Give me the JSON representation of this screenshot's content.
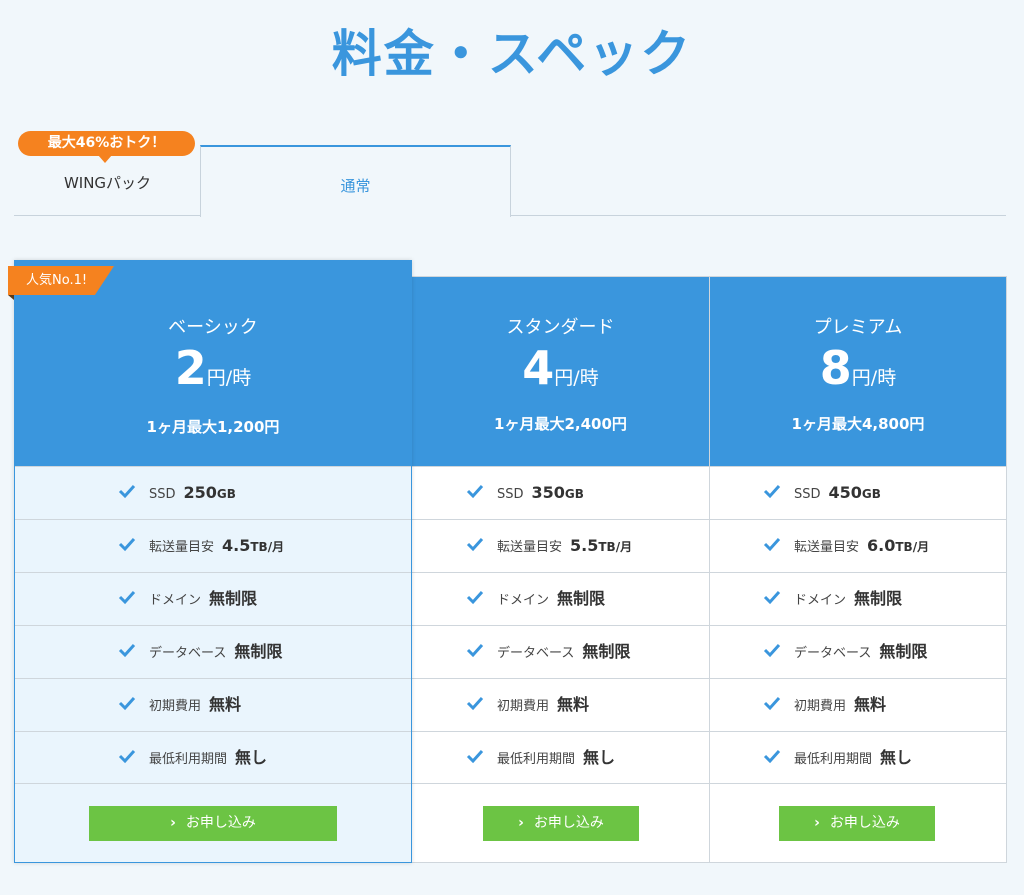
{
  "page_title": "料金・スペック",
  "tabs": {
    "wing": {
      "label": "WINGパック",
      "badge": "最大46%おトク！"
    },
    "normal": {
      "label": "通常"
    }
  },
  "popular_badge": "人気No.1!",
  "plans": [
    {
      "name": "ベーシック",
      "price": "2",
      "price_unit": "円/時",
      "monthly": "1ヶ月最大1,200円",
      "specs": [
        {
          "label": "SSD",
          "value": "250",
          "unit": "GB"
        },
        {
          "label": "転送量目安",
          "value": "4.5",
          "unit": "TB/月"
        },
        {
          "label": "ドメイン",
          "value": "無制限",
          "unit": ""
        },
        {
          "label": "データベース",
          "value": "無制限",
          "unit": ""
        },
        {
          "label": "初期費用",
          "value": "無料",
          "unit": ""
        },
        {
          "label": "最低利用期間",
          "value": "無し",
          "unit": ""
        }
      ],
      "cta": "お申し込み"
    },
    {
      "name": "スタンダード",
      "price": "4",
      "price_unit": "円/時",
      "monthly": "1ヶ月最大2,400円",
      "specs": [
        {
          "label": "SSD",
          "value": "350",
          "unit": "GB"
        },
        {
          "label": "転送量目安",
          "value": "5.5",
          "unit": "TB/月"
        },
        {
          "label": "ドメイン",
          "value": "無制限",
          "unit": ""
        },
        {
          "label": "データベース",
          "value": "無制限",
          "unit": ""
        },
        {
          "label": "初期費用",
          "value": "無料",
          "unit": ""
        },
        {
          "label": "最低利用期間",
          "value": "無し",
          "unit": ""
        }
      ],
      "cta": "お申し込み"
    },
    {
      "name": "プレミアム",
      "price": "8",
      "price_unit": "円/時",
      "monthly": "1ヶ月最大4,800円",
      "specs": [
        {
          "label": "SSD",
          "value": "450",
          "unit": "GB"
        },
        {
          "label": "転送量目安",
          "value": "6.0",
          "unit": "TB/月"
        },
        {
          "label": "ドメイン",
          "value": "無制限",
          "unit": ""
        },
        {
          "label": "データベース",
          "value": "無制限",
          "unit": ""
        },
        {
          "label": "初期費用",
          "value": "無料",
          "unit": ""
        },
        {
          "label": "最低利用期間",
          "value": "無し",
          "unit": ""
        }
      ],
      "cta": "お申し込み"
    }
  ],
  "colors": {
    "accent": "#3a96dd",
    "orange": "#f5821f",
    "green": "#6cc444",
    "background": "#f1f7fb"
  },
  "icons": {
    "check": "check-icon",
    "cta": "chevron-right-icon"
  }
}
